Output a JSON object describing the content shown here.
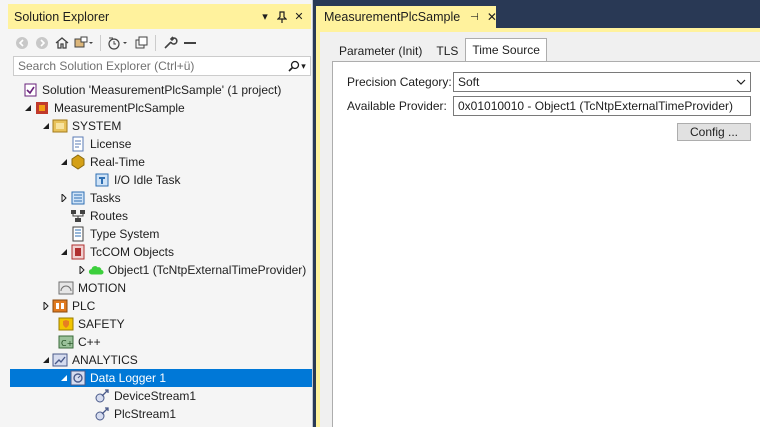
{
  "solution_explorer": {
    "title": "Solution Explorer",
    "search_placeholder": "Search Solution Explorer (Ctrl+ü)",
    "tree": [
      {
        "label": "Solution 'MeasurementPlcSample' (1 project)"
      },
      {
        "label": "MeasurementPlcSample"
      },
      {
        "label": "SYSTEM"
      },
      {
        "label": "License"
      },
      {
        "label": "Real-Time"
      },
      {
        "label": "I/O Idle Task"
      },
      {
        "label": "Tasks"
      },
      {
        "label": "Routes"
      },
      {
        "label": "Type System"
      },
      {
        "label": "TcCOM Objects"
      },
      {
        "label": "Object1 (TcNtpExternalTimeProvider)"
      },
      {
        "label": "MOTION"
      },
      {
        "label": "PLC"
      },
      {
        "label": "SAFETY"
      },
      {
        "label": "C++"
      },
      {
        "label": "ANALYTICS"
      },
      {
        "label": "Data Logger 1"
      },
      {
        "label": "DeviceStream1"
      },
      {
        "label": "PlcStream1"
      }
    ]
  },
  "document": {
    "tab_title": "MeasurementPlcSample",
    "property_tabs": [
      "Parameter (Init)",
      "TLS",
      "Time Source"
    ],
    "active_tab": "Time Source",
    "fields": {
      "precision_label": "Precision Category:",
      "precision_value": "Soft",
      "provider_label": "Available Provider:",
      "provider_value": "0x01010010 - Object1 (TcNtpExternalTimeProvider)",
      "config_button": "Config ..."
    }
  },
  "colors": {
    "active_title": "#fff29d",
    "background": "#293955",
    "selection": "#0078d7"
  }
}
